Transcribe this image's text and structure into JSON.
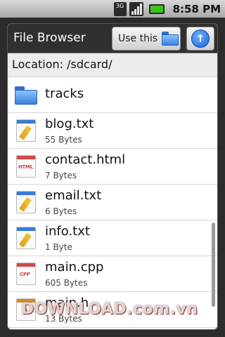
{
  "statusbar": {
    "network_label": "3G",
    "time": "8:58 PM",
    "battery_color": "#3fc41c"
  },
  "dialog": {
    "title": "File Browser",
    "use_this_label": "Use this",
    "up_icon": "up-arrow-icon",
    "location_label": "Location: /sdcard/"
  },
  "files": [
    {
      "name": "tracks",
      "size": "",
      "type": "folder",
      "icon": "folder-icon"
    },
    {
      "name": "blog.txt",
      "size": "55 Bytes",
      "type": "txt",
      "icon": "text-file-icon"
    },
    {
      "name": "contact.html",
      "size": "7 Bytes",
      "type": "html",
      "icon": "html-file-icon"
    },
    {
      "name": "email.txt",
      "size": "6 Bytes",
      "type": "txt",
      "icon": "text-file-icon"
    },
    {
      "name": "info.txt",
      "size": "1 Byte",
      "type": "txt",
      "icon": "text-file-icon"
    },
    {
      "name": "main.cpp",
      "size": "605 Bytes",
      "type": "cpp",
      "icon": "cpp-file-icon"
    },
    {
      "name": "main.h",
      "size": "13 Bytes",
      "type": "h",
      "icon": "header-file-icon"
    }
  ],
  "watermark": "DOWNLOAD.com.vn"
}
